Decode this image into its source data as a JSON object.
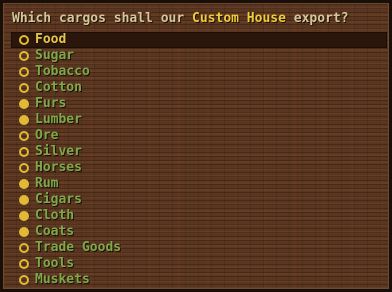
{
  "dialog": {
    "prompt_before": "Which cargos shall our ",
    "prompt_highlight": "Custom House",
    "prompt_after": " export?"
  },
  "colors": {
    "item_text": "#7fa84a",
    "selected_text": "#e6c64a",
    "prompt_text": "#d6c79a",
    "highlight": "#f0cc3a",
    "checkbox": "#e2b933"
  },
  "cargos": [
    {
      "label": "Food",
      "exported": false,
      "selected": true
    },
    {
      "label": "Sugar",
      "exported": false,
      "selected": false
    },
    {
      "label": "Tobacco",
      "exported": false,
      "selected": false
    },
    {
      "label": "Cotton",
      "exported": false,
      "selected": false
    },
    {
      "label": "Furs",
      "exported": true,
      "selected": false
    },
    {
      "label": "Lumber",
      "exported": true,
      "selected": false
    },
    {
      "label": "Ore",
      "exported": false,
      "selected": false
    },
    {
      "label": "Silver",
      "exported": false,
      "selected": false
    },
    {
      "label": "Horses",
      "exported": false,
      "selected": false
    },
    {
      "label": "Rum",
      "exported": true,
      "selected": false
    },
    {
      "label": "Cigars",
      "exported": true,
      "selected": false
    },
    {
      "label": "Cloth",
      "exported": true,
      "selected": false
    },
    {
      "label": "Coats",
      "exported": true,
      "selected": false
    },
    {
      "label": "Trade Goods",
      "exported": false,
      "selected": false
    },
    {
      "label": "Tools",
      "exported": false,
      "selected": false
    },
    {
      "label": "Muskets",
      "exported": false,
      "selected": false
    }
  ]
}
